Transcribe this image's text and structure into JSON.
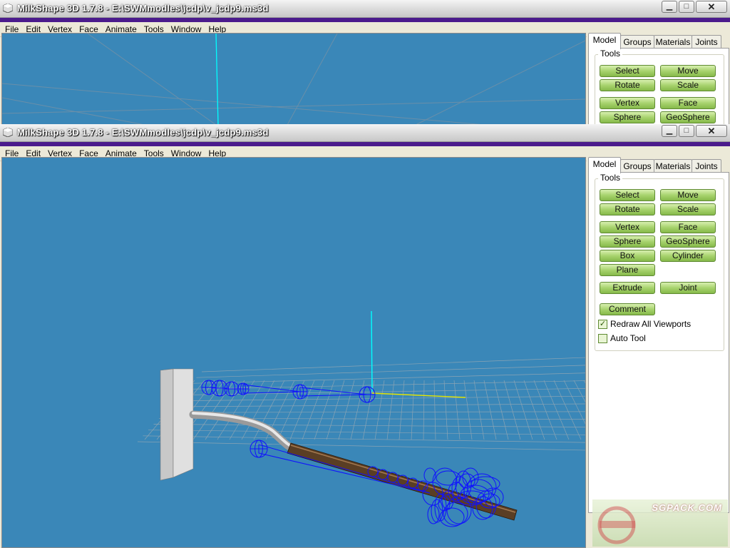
{
  "window": {
    "title": "MilkShape 3D 1.7.8 - E:\\SWMmodles\\jcdp\\v_jcdp9.ms3d",
    "controls": {
      "minimize": "▁",
      "maximize": "□",
      "close": "✕"
    }
  },
  "menu": [
    {
      "label": "File",
      "mnemonic": "F"
    },
    {
      "label": "Edit",
      "mnemonic": "E"
    },
    {
      "label": "Vertex",
      "mnemonic": "V"
    },
    {
      "label": "Face",
      "mnemonic": "c"
    },
    {
      "label": "Animate",
      "mnemonic": "A"
    },
    {
      "label": "Tools",
      "mnemonic": "T"
    },
    {
      "label": "Window",
      "mnemonic": "W"
    },
    {
      "label": "Help",
      "mnemonic": "H"
    }
  ],
  "panel": {
    "tabs": [
      "Model",
      "Groups",
      "Materials",
      "Joints"
    ],
    "active_tab": "Model",
    "tools_label": "Tools",
    "buttons": {
      "select": "Select",
      "move": "Move",
      "rotate": "Rotate",
      "scale": "Scale",
      "vertex": "Vertex",
      "face": "Face",
      "sphere": "Sphere",
      "geosphere": "GeoSphere",
      "box": "Box",
      "cylinder": "Cylinder",
      "plane": "Plane",
      "extrude": "Extrude",
      "joint": "Joint",
      "comment": "Comment"
    },
    "redraw_all": {
      "label": "Redraw All Viewports",
      "checked": true
    },
    "auto_tool": {
      "label": "Auto Tool",
      "checked": false
    }
  },
  "watermark": "SGPACK.COM",
  "colors": {
    "viewport_bg": "#3a87b8",
    "button_green": "#a8d36e",
    "title_purple": "#4b1b8c"
  }
}
